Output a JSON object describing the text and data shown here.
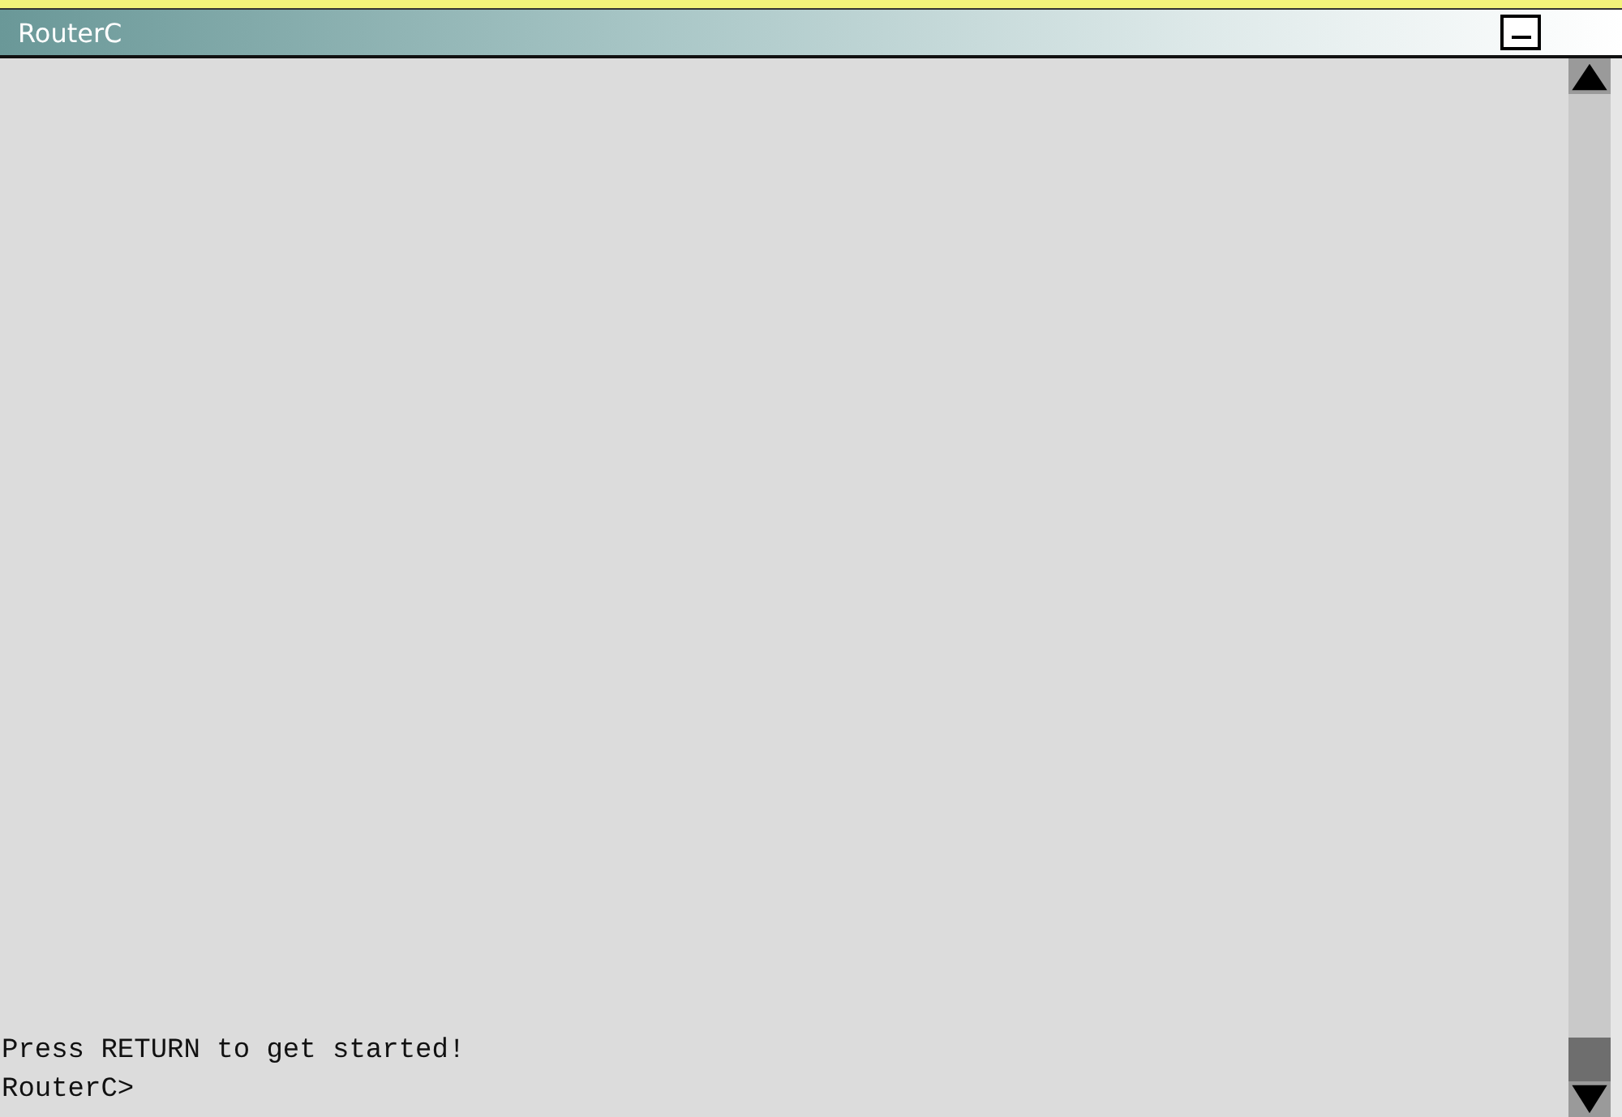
{
  "window": {
    "title": "RouterC"
  },
  "terminal": {
    "lines": [
      "Press RETURN to get started!",
      "RouterC>"
    ]
  }
}
